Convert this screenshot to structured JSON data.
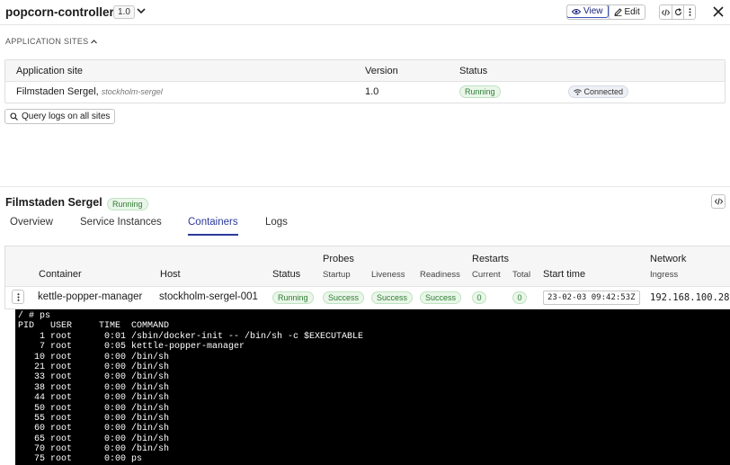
{
  "header": {
    "title": "popcorn-controller",
    "version": "1.0",
    "view_label": "View",
    "edit_label": "Edit"
  },
  "sites": {
    "heading": "APPLICATION SITES",
    "columns": {
      "site": "Application site",
      "version": "Version",
      "status": "Status"
    },
    "rows": [
      {
        "name": "Filmstaden Sergel",
        "sub": "stockholm-sergel",
        "version": "1.0",
        "status": "Running",
        "connection": "Connected"
      }
    ],
    "query_label": "Query logs on all sites"
  },
  "detail": {
    "title": "Filmstaden Sergel",
    "status": "Running",
    "tabs": [
      "Overview",
      "Service Instances",
      "Containers",
      "Logs"
    ],
    "active_tab": "Containers"
  },
  "containers": {
    "groups": {
      "probes": "Probes",
      "restarts": "Restarts",
      "network": "Network"
    },
    "columns": {
      "container": "Container",
      "host": "Host",
      "status": "Status",
      "startup": "Startup",
      "liveness": "Liveness",
      "readiness": "Readiness",
      "current": "Current",
      "total": "Total",
      "start_time": "Start time",
      "ingress": "Ingress"
    },
    "rows": [
      {
        "container": "kettle-popper-manager",
        "host": "stockholm-sergel-001",
        "status": "Running",
        "startup": "Success",
        "liveness": "Success",
        "readiness": "Success",
        "current": "0",
        "total": "0",
        "start_time": "23-02-03 09:42:53Z",
        "ingress": "192.168.100.28"
      }
    ]
  },
  "terminal": {
    "lines": [
      "/ # ps",
      "PID   USER     TIME  COMMAND",
      "    1 root      0:01 /sbin/docker-init -- /bin/sh -c $EXECUTABLE",
      "    7 root      0:05 kettle-popper-manager",
      "   10 root      0:00 /bin/sh",
      "   21 root      0:00 /bin/sh",
      "   33 root      0:00 /bin/sh",
      "   38 root      0:00 /bin/sh",
      "   44 root      0:00 /bin/sh",
      "   50 root      0:00 /bin/sh",
      "   55 root      0:00 /bin/sh",
      "   60 root      0:00 /bin/sh",
      "   65 root      0:00 /bin/sh",
      "   70 root      0:00 /bin/sh",
      "   75 root      0:00 ps"
    ]
  },
  "colors": {
    "accent": "#2b3a9c",
    "success_green": "#2e7d32",
    "terminal_bg": "#000000"
  },
  "icons": [
    "chevron-down-icon",
    "eye-icon",
    "pencil-icon",
    "code-icon",
    "refresh-icon",
    "more-vertical-icon",
    "close-icon",
    "chevron-up-icon",
    "search-icon",
    "wifi-icon"
  ]
}
